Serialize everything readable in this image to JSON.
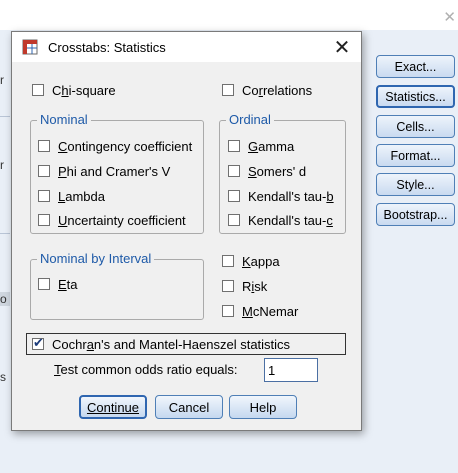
{
  "parent_window": {
    "side_buttons": [
      {
        "label": "Exact...",
        "u": "x"
      },
      {
        "label": "Statistics...",
        "u": "S"
      },
      {
        "label": "Cells...",
        "u": "l"
      },
      {
        "label": "Format...",
        "u": "F"
      },
      {
        "label": "Style...",
        "u": "y"
      },
      {
        "label": "Bootstrap...",
        "u": "a"
      }
    ],
    "fragments": [
      "r",
      "r",
      "o",
      "s"
    ]
  },
  "dialog": {
    "title": "Crosstabs: Statistics",
    "chi_square": {
      "pre": "C",
      "u": "h",
      "post": "i-square",
      "checked": false
    },
    "correlations": {
      "pre": "Co",
      "u": "r",
      "post": "relations",
      "checked": false
    },
    "nominal": {
      "title": "Nominal",
      "items": [
        {
          "pre": "",
          "u": "C",
          "post": "ontingency coefficient",
          "checked": false
        },
        {
          "pre": "",
          "u": "P",
          "post": "hi and Cramer's V",
          "checked": false
        },
        {
          "pre": "",
          "u": "L",
          "post": "ambda",
          "checked": false
        },
        {
          "pre": "",
          "u": "U",
          "post": "ncertainty coefficient",
          "checked": false
        }
      ]
    },
    "ordinal": {
      "title": "Ordinal",
      "items": [
        {
          "pre": "",
          "u": "G",
          "post": "amma",
          "checked": false
        },
        {
          "pre": "",
          "u": "S",
          "post": "omers' d",
          "checked": false
        },
        {
          "pre": "Kendall's tau-",
          "u": "b",
          "post": "",
          "checked": false
        },
        {
          "pre": "Kendall's tau-",
          "u": "c",
          "post": "",
          "checked": false
        }
      ]
    },
    "nominal_by_interval": {
      "title": "Nominal by Interval",
      "items": [
        {
          "pre": "",
          "u": "E",
          "post": "ta",
          "checked": false
        }
      ]
    },
    "others": [
      {
        "pre": "",
        "u": "K",
        "post": "appa",
        "checked": false
      },
      {
        "pre": "R",
        "u": "i",
        "post": "sk",
        "checked": false
      },
      {
        "pre": "",
        "u": "M",
        "post": "cNemar",
        "checked": false
      }
    ],
    "cochran": {
      "pre": "Cochr",
      "u": "a",
      "post": "n's and Mantel-Haenszel statistics",
      "checked": true
    },
    "odds": {
      "pre": "",
      "u": "T",
      "post": "est common odds ratio equals:",
      "value": "1"
    },
    "buttons": {
      "continue": "Continue",
      "cancel": "Cancel",
      "help": "Help"
    },
    "close_symbol": "✕"
  },
  "bg_close_symbol": "✕"
}
